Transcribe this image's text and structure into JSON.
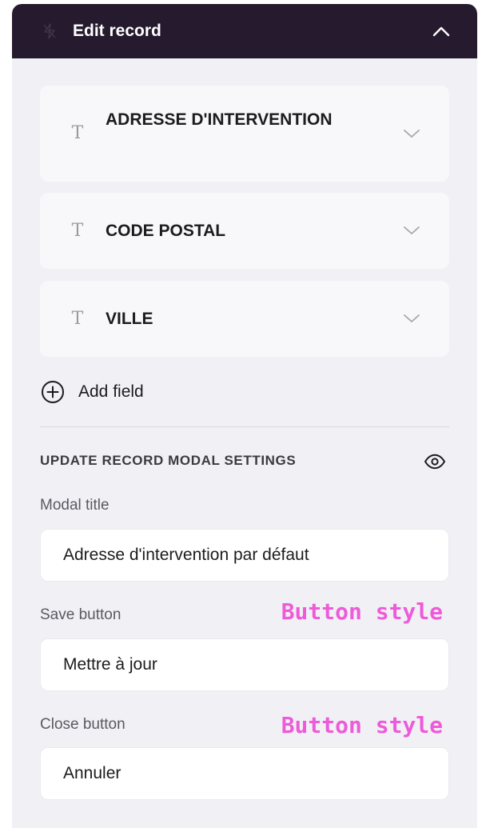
{
  "header": {
    "title": "Edit record",
    "leading_icon": "zap-off-icon",
    "trailing_icon": "chevron-up-icon",
    "background_color": "#261b2e"
  },
  "fields": [
    {
      "type_icon": "text-type-icon",
      "label": "ADRESSE D'INTERVENTION"
    },
    {
      "type_icon": "text-type-icon",
      "label": "CODE POSTAL"
    },
    {
      "type_icon": "text-type-icon",
      "label": "VILLE"
    }
  ],
  "add_field": {
    "label": "Add field",
    "icon": "plus-circle-icon"
  },
  "modal_settings": {
    "section_title": "UPDATE RECORD MODAL SETTINGS",
    "visibility_icon": "eye-icon",
    "modal_title": {
      "label": "Modal title",
      "value": "Adresse d'intervention par défaut"
    },
    "save_button": {
      "label": "Save button",
      "annotation": "Button style",
      "value": "Mettre à jour"
    },
    "close_button": {
      "label": "Close button",
      "annotation": "Button style",
      "value": "Annuler"
    }
  },
  "colors": {
    "panel_background": "#f1f0f5",
    "annotation": "#ee5bd9"
  }
}
